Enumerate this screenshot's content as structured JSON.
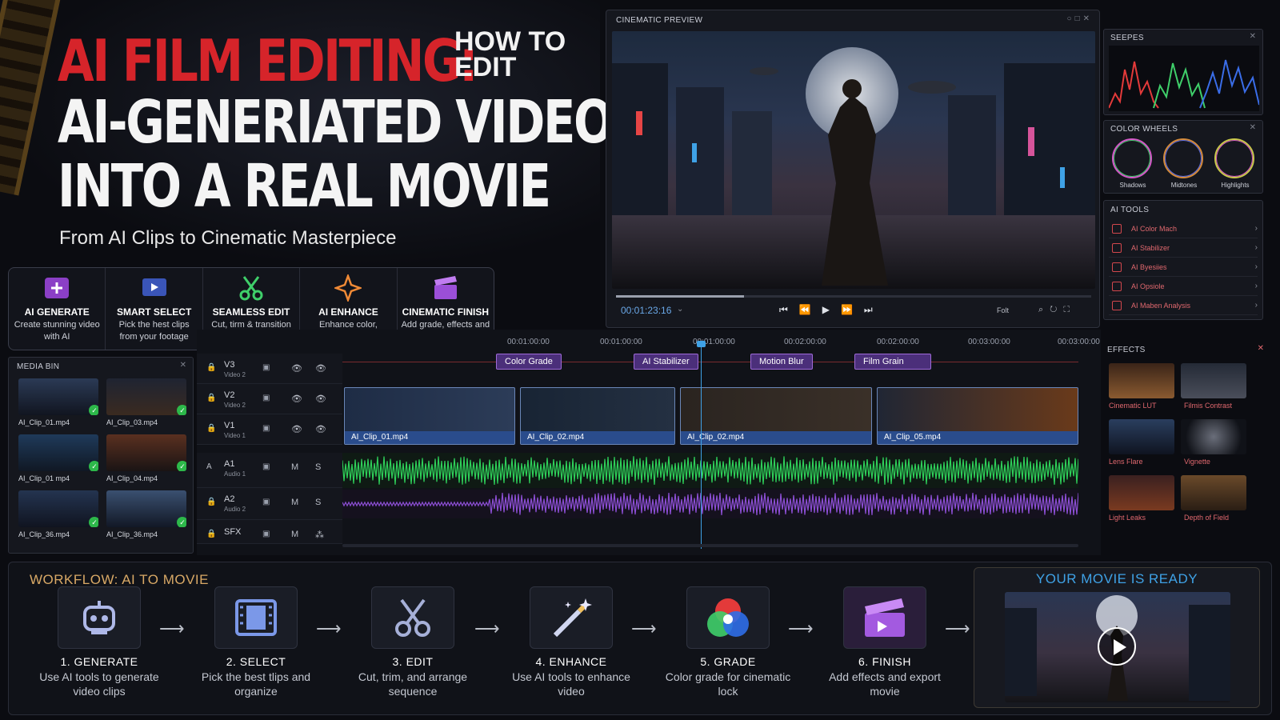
{
  "hero": {
    "title_red": "AI FILM EDITING:",
    "title_side": "HOW TO EDIT",
    "title_line2": "AI-GENERIATED VIDEO",
    "title_line3": "INTO A REAL MOVIE",
    "subtitle": "From AI Clips to Cinematic Masterpiece"
  },
  "features": [
    {
      "title": "AI GENERATE",
      "desc": "Create stunning video with AI",
      "icon": "ai-generate-icon",
      "color": "#b15ee6"
    },
    {
      "title": "SMART SELECT",
      "desc": "Pick the hest clips from your footage",
      "icon": "smart-select-icon",
      "color": "#6b8be0"
    },
    {
      "title": "SEAMLESS EDIT",
      "desc": "Cut, tirm & transition with precision",
      "icon": "scissors-icon",
      "color": "#3fcf6a"
    },
    {
      "title": "AI ENHANCE",
      "desc": "Enhance color, lighting, and detail",
      "icon": "sparkle-icon",
      "color": "#f08a36"
    },
    {
      "title": "CINEMATIC FINISH",
      "desc": "Add grade, effects and final look",
      "icon": "clapperboard-icon",
      "color": "#b15ee6"
    }
  ],
  "preview": {
    "title": "CINEMATIC PREVIEW",
    "timecode": "00:01:23:16",
    "fit": "Folt",
    "progress": 0.27
  },
  "scopes": {
    "title": "SEEPES"
  },
  "wheels": {
    "title": "COLOR WHEELS",
    "items": [
      "Shadows",
      "Midtones",
      "Highlights"
    ]
  },
  "ai_tools": {
    "title": "AI TOOLS",
    "items": [
      "AI Color Mach",
      "AI Stabilizer",
      "AI Byesiies",
      "AI Opsiole",
      "AI Maben Analysis"
    ]
  },
  "media_bin": {
    "title": "MEDIA BIN",
    "items": [
      "AI_Clip_01.mp4",
      "AI_Clip_03.mp4",
      "AI_Clip_01 mp4",
      "AI_Clip_04.mp4",
      "AI_Clip_36.mp4",
      "AI_Clip_36.mp4"
    ]
  },
  "timeline": {
    "ruler": [
      "00:01:00:00",
      "00:01:00:00",
      "00:01:00:00",
      "00:02:00:00",
      "00:02:00:00",
      "00:03:00:00",
      "00:03:00:00"
    ],
    "tracks": [
      {
        "key": "V3",
        "name": "V3",
        "sub": "Video 2",
        "c2": "👁",
        "c3": "👁"
      },
      {
        "key": "V2",
        "name": "V2",
        "sub": "Video 2",
        "c2": "👁",
        "c3": "👁"
      },
      {
        "key": "V1",
        "name": "V1",
        "sub": "Video 1",
        "c2": "👁",
        "c3": "👁"
      },
      {
        "key": "A1",
        "name": "A1",
        "sub": "Audio 1",
        "c2": "M",
        "c3": "S"
      },
      {
        "key": "A2",
        "name": "A2",
        "sub": "Audio 2",
        "c2": "M",
        "c3": "S"
      },
      {
        "key": "SFX",
        "name": "SFX",
        "sub": "",
        "c2": "M",
        "c3": "⁂"
      }
    ],
    "effects": [
      "Color Grade",
      "AI Stabilizer",
      "Motion Blur",
      "Film Grain"
    ],
    "clips": [
      "AI_Clip_01.mp4",
      "AI_Clip_02.mp4",
      "AI_Clip_02.mp4",
      "AI_Clip_05.mp4"
    ]
  },
  "effects_panel": {
    "title": "EFFECTS",
    "items": [
      "Cinematic LUT",
      "Filmis Contrast",
      "Lens Flare",
      "Vignette",
      "Light Leaks",
      "Depth of Field"
    ]
  },
  "workflow": {
    "title": "WORKFLOW: AI TO MOVIE",
    "steps": [
      {
        "title": "1. GENERATE",
        "desc": "Use AI tools to generate video clips"
      },
      {
        "title": "2. SELECT",
        "desc": "Pick the best tlips and organize"
      },
      {
        "title": "3. EDIT",
        "desc": "Cut, trim, and arrange sequence"
      },
      {
        "title": "4. ENHANCE",
        "desc": "Use AI tools to enhance video"
      },
      {
        "title": "5. GRADE",
        "desc": "Color grade for cinematic lock"
      },
      {
        "title": "6. FINISH",
        "desc": "Add effects and export movie"
      }
    ],
    "ready": "YOUR MOVIE IS READY"
  },
  "colors": {
    "accent_red": "#d6242a",
    "accent_blue": "#3fa2e6",
    "purple": "#9e6ad8",
    "audio_green": "#2fd15a",
    "audio_purple": "#8d4fd6"
  }
}
